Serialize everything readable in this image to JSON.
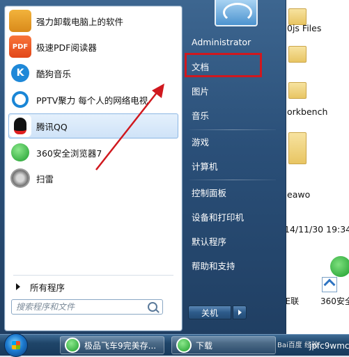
{
  "start_menu": {
    "programs": [
      {
        "label": "强力卸载电脑上的软件",
        "icon": "uninstall-icon",
        "icon_text": ""
      },
      {
        "label": "极速PDF阅读器",
        "icon": "pdf-reader-icon",
        "icon_text": "PDF"
      },
      {
        "label": "酷狗音乐",
        "icon": "kugou-icon",
        "icon_text": "K"
      },
      {
        "label": "PPTV聚力 每个人的网络电视",
        "icon": "pptv-icon",
        "icon_text": ""
      },
      {
        "label": "腾讯QQ",
        "icon": "qq-icon",
        "icon_text": "",
        "selected": true
      },
      {
        "label": "360安全浏览器7",
        "icon": "360-browser-icon",
        "icon_text": ""
      },
      {
        "label": "扫雷",
        "icon": "minesweeper-icon",
        "icon_text": ""
      }
    ],
    "all_programs_label": "所有程序",
    "search_placeholder": "搜索程序和文件",
    "right_items": {
      "user": "Administrator",
      "documents": "文档",
      "pictures": "图片",
      "music": "音乐",
      "games": "游戏",
      "computer": "计算机",
      "control_panel": "控制面板",
      "devices_printers": "设备和打印机",
      "default_programs": "默认程序",
      "help_support": "帮助和支持"
    },
    "shutdown_label": "关机"
  },
  "background": {
    "explorer_items": [
      "0js Files",
      "orkbench",
      "eawo",
      "14/11/30 19:34"
    ],
    "desktop_icons": [
      "IE联",
      "360安全"
    ]
  },
  "taskbar": {
    "buttons": [
      "极品飞车9完美存...",
      "下载"
    ],
    "extra_text": "jpfc9wmc",
    "watermark": "Bai百度 经验"
  },
  "colors": {
    "menu_blue": "#2a4f78",
    "highlight_red": "#d0181e",
    "arrow_red": "#d0181e",
    "taskbar": "#173a5c"
  }
}
